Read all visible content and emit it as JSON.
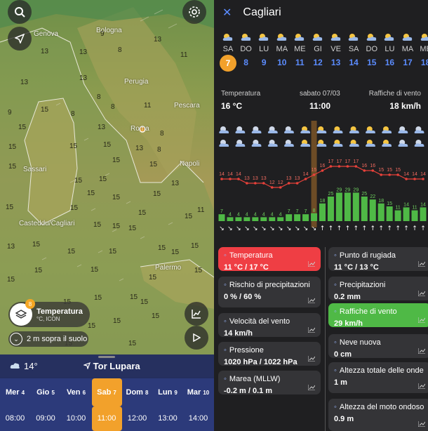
{
  "map": {
    "cities": [
      "Genova",
      "Bologna",
      "Perugia",
      "Pescara",
      "Roma",
      "Napoli",
      "Sassari",
      "Casteddu/Cagliari",
      "Palermo"
    ],
    "wind_values": [
      "13",
      "13",
      "8",
      "9",
      "13",
      "11",
      "13",
      "13",
      "8",
      "15",
      "9",
      "8",
      "8",
      "11",
      "15",
      "13",
      "8",
      "15",
      "15",
      "15",
      "13",
      "8",
      "15",
      "15",
      "15",
      "13",
      "15",
      "15",
      "15",
      "11",
      "15",
      "15",
      "15",
      "15",
      "15",
      "15",
      "15",
      "15",
      "13",
      "15",
      "15",
      "15",
      "15",
      "15",
      "15",
      "15",
      "15",
      "15",
      "15",
      "15",
      "15",
      "15",
      "15",
      "15",
      "15",
      "15",
      "15",
      "15",
      "15",
      "15"
    ],
    "layer_title": "Temperatura",
    "layer_subtitle": "°C, ICON",
    "layer_badge": "8",
    "height_label": "2 m sopra il suolo"
  },
  "timeline": {
    "current_temp": "14°",
    "location": "Tor Lupara",
    "days": [
      {
        "name": "Mer",
        "num": "4"
      },
      {
        "name": "Gio",
        "num": "5"
      },
      {
        "name": "Ven",
        "num": "6"
      },
      {
        "name": "Sab",
        "num": "7"
      },
      {
        "name": "Dom",
        "num": "8"
      },
      {
        "name": "Lun",
        "num": "9"
      },
      {
        "name": "Mar",
        "num": "10"
      }
    ],
    "hours": [
      "08:00",
      "09:00",
      "10:00",
      "11:00",
      "12:00",
      "13:00",
      "14:00"
    ]
  },
  "panel": {
    "city": "Cagliari",
    "day_strip": [
      {
        "name": "SA",
        "num": "7"
      },
      {
        "name": "DO",
        "num": "8"
      },
      {
        "name": "LU",
        "num": "9"
      },
      {
        "name": "MA",
        "num": "10"
      },
      {
        "name": "ME",
        "num": "11"
      },
      {
        "name": "GI",
        "num": "12"
      },
      {
        "name": "VE",
        "num": "13"
      },
      {
        "name": "SA",
        "num": "14"
      },
      {
        "name": "DO",
        "num": "15"
      },
      {
        "name": "LU",
        "num": "16"
      },
      {
        "name": "MA",
        "num": "17"
      },
      {
        "name": "ME",
        "num": "18"
      }
    ],
    "info": {
      "temp_label": "Temperatura",
      "temp_value": "16 °C",
      "date_label": "sabato 07/03",
      "time_value": "11:00",
      "gust_label": "Raffiche di vento",
      "gust_value": "18 km/h"
    },
    "temp_series": [
      14,
      14,
      14,
      13,
      13,
      13,
      12,
      12,
      13,
      13,
      14,
      15,
      16,
      17,
      17,
      17,
      17,
      16,
      16,
      15,
      15,
      15,
      14,
      14,
      14
    ],
    "wind_series": [
      7,
      4,
      4,
      4,
      4,
      4,
      4,
      4,
      7,
      7,
      7,
      8,
      18,
      25,
      29,
      29,
      29,
      25,
      22,
      18,
      15,
      11,
      14,
      11,
      14
    ],
    "hour_labels": [
      "01:00",
      "04:00",
      "07:00",
      "10:00",
      "13:00",
      "16:00",
      "19:00",
      "22:00"
    ],
    "cards_left": [
      {
        "title": "Temperatura",
        "value": "11 °C / 17 °C",
        "icon": "thermometer-icon"
      },
      {
        "title": "Rischio di precipitazioni",
        "value": "0 % / 60 %",
        "icon": "drops-icon"
      },
      {
        "title": "Velocità del vento",
        "value": "14 km/h",
        "icon": "wind-icon"
      },
      {
        "title": "Pressione",
        "value": "1020 hPa / 1022 hPa",
        "icon": "pressure-icon"
      },
      {
        "title": "Marea (MLLW)",
        "value": "-0.2 m / 0.1 m",
        "icon": "tide-icon"
      }
    ],
    "cards_right": [
      {
        "title": "Punto di rugiada",
        "value": "11 °C / 13 °C",
        "icon": "dewpoint-icon"
      },
      {
        "title": "Precipitazioni",
        "value": "0.2 mm",
        "icon": "rain-icon"
      },
      {
        "title": "Raffiche di vento",
        "value": "29 km/h",
        "icon": "gust-icon"
      },
      {
        "title": "Neve nuova",
        "value": "0 cm",
        "icon": "snow-icon"
      },
      {
        "title": "Altezza totale delle onde",
        "value": "1 m",
        "icon": "wave-icon"
      },
      {
        "title": "Altezza del moto ondoso",
        "value": "0.9 m",
        "icon": "wave-icon"
      }
    ]
  },
  "colors": {
    "accent": "#f2a12b",
    "temp_line": "#e8413a",
    "wind_bar": "#4fb946",
    "day_num": "#5b8cff"
  }
}
